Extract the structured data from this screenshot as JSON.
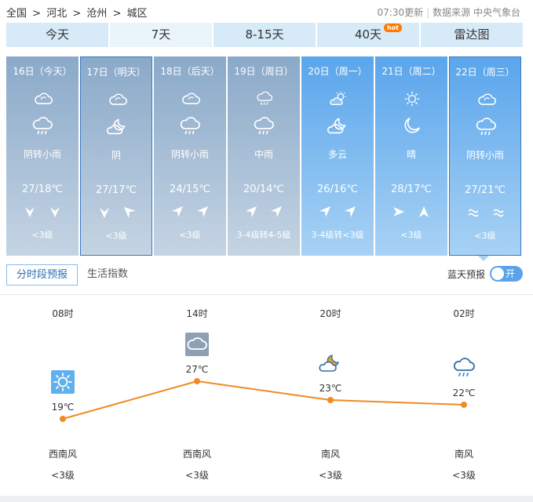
{
  "breadcrumb": [
    "全国",
    "河北",
    "沧州",
    "城区"
  ],
  "breadcrumb_sep": ">",
  "update_time": "07:30更新",
  "source": "数据来源 中央气象台",
  "tabs": [
    {
      "label": "今天"
    },
    {
      "label": "7天",
      "active": true
    },
    {
      "label": "8-15天"
    },
    {
      "label": "40天",
      "badge": "hot"
    },
    {
      "label": "雷达图"
    }
  ],
  "days": [
    {
      "date": "16日（今天）",
      "icon_day": "cloudy-icon",
      "icon_night": "rain-cloud-icon",
      "desc": "阴转小雨",
      "temp": "27/18℃",
      "wind_icons": [
        "arrow-down-icon",
        "arrow-down-icon"
      ],
      "wind": "<3级",
      "past": true
    },
    {
      "date": "17日（明天）",
      "icon_day": "cloudy-icon",
      "icon_night": "cloud-moon-icon",
      "desc": "阴",
      "temp": "27/17℃",
      "wind_icons": [
        "arrow-down-icon",
        "arrow-down-left-icon"
      ],
      "wind": "<3级",
      "past": true,
      "selected": true
    },
    {
      "date": "18日（后天）",
      "icon_day": "cloudy-icon",
      "icon_night": "rain-cloud-icon",
      "desc": "阴转小雨",
      "temp": "24/15℃",
      "wind_icons": [
        "arrow-up-right-icon",
        "arrow-up-right-icon"
      ],
      "wind": "<3级",
      "past": true
    },
    {
      "date": "19日（周日）",
      "icon_day": "rain-cloud-icon",
      "icon_night": "rain-cloud-icon",
      "desc": "中雨",
      "temp": "20/14℃",
      "wind_icons": [
        "arrow-up-right-icon",
        "arrow-up-right-icon"
      ],
      "wind": "3-4级转4-5级",
      "past": true
    },
    {
      "date": "20日（周一）",
      "icon_day": "sun-cloud-icon",
      "icon_night": "cloud-moon-icon",
      "desc": "多云",
      "temp": "26/16℃",
      "wind_icons": [
        "arrow-up-right-icon",
        "arrow-up-right-icon"
      ],
      "wind": "3-4级转<3级",
      "past": false
    },
    {
      "date": "21日（周二）",
      "icon_day": "sun-icon",
      "icon_night": "moon-icon",
      "desc": "晴",
      "temp": "28/17℃",
      "wind_icons": [
        "arrow-right-icon",
        "arrow-up-icon"
      ],
      "wind": "<3级",
      "past": false
    },
    {
      "date": "22日（周三）",
      "icon_day": "cloudy-icon",
      "icon_night": "rain-cloud-icon",
      "desc": "阴转小雨",
      "temp": "27/21℃",
      "wind_icons": [
        "wave-icon",
        "wave-icon"
      ],
      "wind": "<3级",
      "past": false,
      "selected": true
    }
  ],
  "subtabs": [
    {
      "label": "分时段预报",
      "active": true
    },
    {
      "label": "生活指数"
    }
  ],
  "bluesky": {
    "label": "蓝天预报",
    "toggle": "开"
  },
  "hourly": [
    {
      "time": "08时",
      "icon": "sun-icon",
      "temp_label": "19℃",
      "temp": 19,
      "wind_dir": "西南风",
      "wind": "<3级"
    },
    {
      "time": "14时",
      "icon": "cloudy-icon",
      "temp_label": "27℃",
      "temp": 27,
      "wind_dir": "西南风",
      "wind": "<3级"
    },
    {
      "time": "20时",
      "icon": "cloud-moon-icon",
      "temp_label": "23℃",
      "temp": 23,
      "wind_dir": "南风",
      "wind": "<3级"
    },
    {
      "time": "02时",
      "icon": "rain-cloud-icon",
      "temp_label": "22℃",
      "temp": 22,
      "wind_dir": "南风",
      "wind": "<3级"
    }
  ],
  "colors": {
    "line": "#f08a24",
    "active_tab": "#eaf4fb",
    "tab": "#d6eaf8",
    "toggle": "#5ba3e8"
  }
}
